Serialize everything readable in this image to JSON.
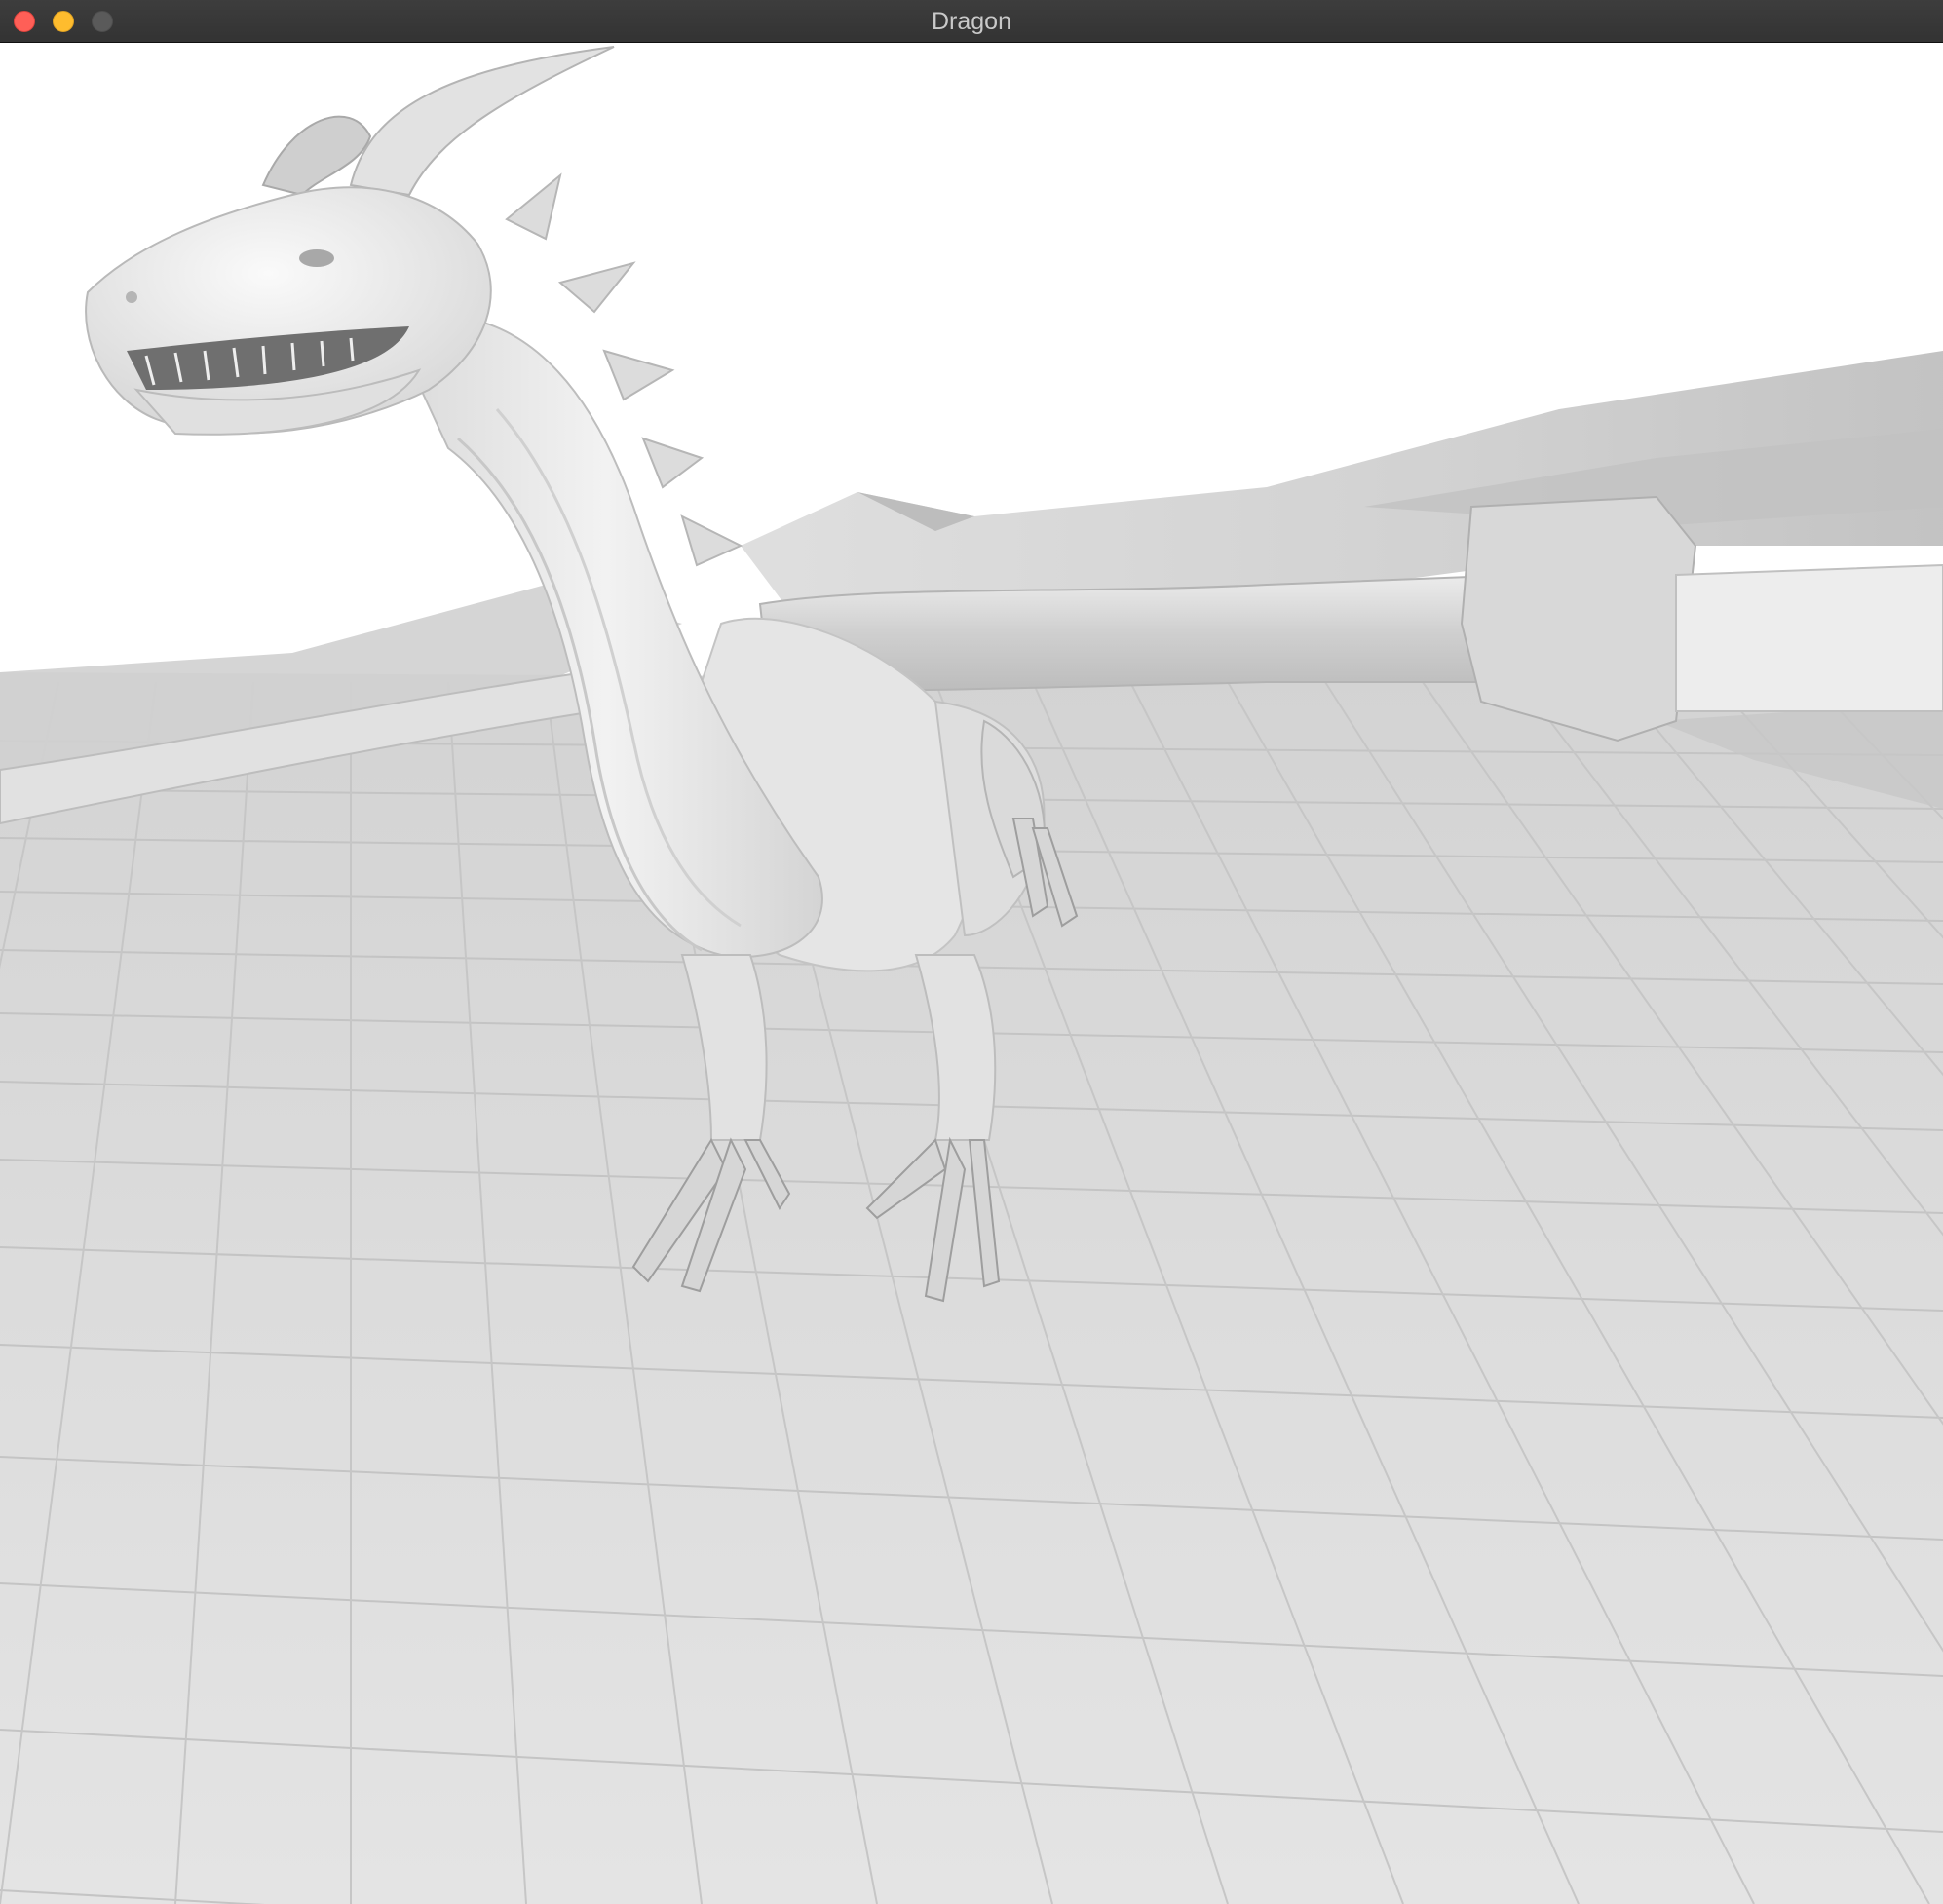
{
  "window": {
    "title": "Dragon",
    "controls": [
      {
        "name": "close",
        "color": "#ff5f57"
      },
      {
        "name": "minimize",
        "color": "#febc2e"
      },
      {
        "name": "zoom",
        "color": "#5a5a5a"
      }
    ]
  },
  "scene": {
    "background_color": "#ffffff",
    "floor_color": "#dcdcdc",
    "model_color": "#e6e6e6",
    "objects": [
      "dragon",
      "tiled-floor",
      "wings"
    ]
  }
}
